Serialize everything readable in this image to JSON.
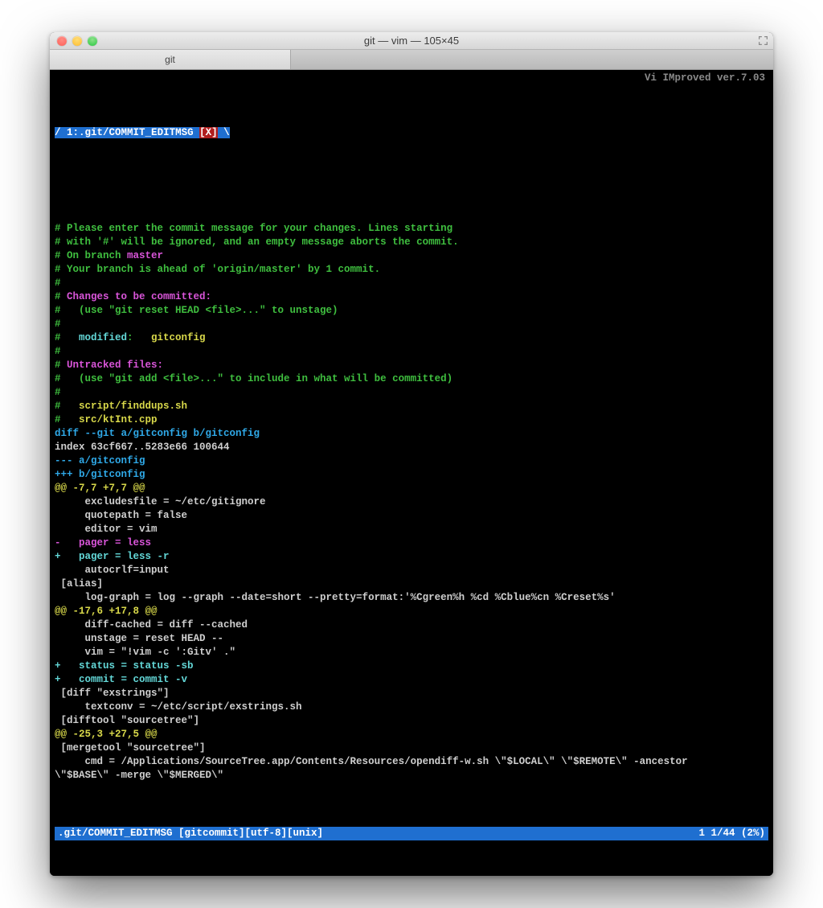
{
  "window": {
    "title": "git — vim — 105×45",
    "tab_label": "git",
    "vim_version": "Vi IMproved ver.7.03",
    "buffer_tab": {
      "index": "1",
      "path": ".git/COMMIT_EDITMSG",
      "modified_flag": "[X]"
    }
  },
  "lines": [
    {
      "t": "comment",
      "segs": [
        [
          "green",
          "# Please enter the commit message for your changes. Lines starting"
        ]
      ]
    },
    {
      "t": "comment",
      "segs": [
        [
          "green",
          "# with '#' will be ignored, and an empty message aborts the commit."
        ]
      ]
    },
    {
      "t": "comment",
      "segs": [
        [
          "green",
          "# On branch "
        ],
        [
          "magenta",
          "master"
        ]
      ]
    },
    {
      "t": "comment",
      "segs": [
        [
          "green",
          "# Your branch is ahead of 'origin/master' by 1 commit."
        ]
      ]
    },
    {
      "t": "comment",
      "segs": [
        [
          "green",
          "#"
        ]
      ]
    },
    {
      "t": "comment",
      "segs": [
        [
          "green",
          "# "
        ],
        [
          "magenta",
          "Changes to be committed:"
        ]
      ]
    },
    {
      "t": "comment",
      "segs": [
        [
          "green",
          "#   (use \"git reset HEAD <file>...\" to unstage)"
        ]
      ]
    },
    {
      "t": "comment",
      "segs": [
        [
          "green",
          "#"
        ]
      ]
    },
    {
      "t": "comment",
      "segs": [
        [
          "green",
          "#   "
        ],
        [
          "cyan",
          "modified"
        ],
        [
          "green",
          ":   "
        ],
        [
          "yellow",
          "gitconfig"
        ]
      ]
    },
    {
      "t": "comment",
      "segs": [
        [
          "green",
          "#"
        ]
      ]
    },
    {
      "t": "comment",
      "segs": [
        [
          "green",
          "# "
        ],
        [
          "magenta",
          "Untracked files:"
        ]
      ]
    },
    {
      "t": "comment",
      "segs": [
        [
          "green",
          "#   (use \"git add <file>...\" to include in what will be committed)"
        ]
      ]
    },
    {
      "t": "comment",
      "segs": [
        [
          "green",
          "#"
        ]
      ]
    },
    {
      "t": "comment",
      "segs": [
        [
          "green",
          "#   "
        ],
        [
          "yellow",
          "script/finddups.sh"
        ]
      ]
    },
    {
      "t": "comment",
      "segs": [
        [
          "green",
          "#   "
        ],
        [
          "yellow",
          "src/ktInt.cpp"
        ]
      ]
    },
    {
      "t": "diff",
      "segs": [
        [
          "blue",
          "diff --git a/gitconfig b/gitconfig"
        ]
      ]
    },
    {
      "t": "diff",
      "segs": [
        [
          "grey",
          "index 63cf667..5283e66 100644"
        ]
      ]
    },
    {
      "t": "diff",
      "segs": [
        [
          "blue",
          "--- a/gitconfig"
        ]
      ]
    },
    {
      "t": "diff",
      "segs": [
        [
          "blue",
          "+++ b/gitconfig"
        ]
      ]
    },
    {
      "t": "hunk",
      "segs": [
        [
          "yellow",
          "@@ -7,7 +7,7 @@"
        ]
      ]
    },
    {
      "t": "ctx",
      "segs": [
        [
          "grey",
          "     excludesfile = ~/etc/gitignore"
        ]
      ]
    },
    {
      "t": "ctx",
      "segs": [
        [
          "grey",
          "     quotepath = false"
        ]
      ]
    },
    {
      "t": "ctx",
      "segs": [
        [
          "grey",
          "     editor = vim"
        ]
      ]
    },
    {
      "t": "del",
      "segs": [
        [
          "magenta",
          "-   pager = less"
        ]
      ]
    },
    {
      "t": "add",
      "segs": [
        [
          "cyan",
          "+   pager = less -r"
        ]
      ]
    },
    {
      "t": "ctx",
      "segs": [
        [
          "grey",
          "     autocrlf=input"
        ]
      ]
    },
    {
      "t": "ctx",
      "segs": [
        [
          "grey",
          " [alias]"
        ]
      ]
    },
    {
      "t": "ctx",
      "segs": [
        [
          "grey",
          "     log-graph = log --graph --date=short --pretty=format:'%Cgreen%h %cd %Cblue%cn %Creset%s'"
        ]
      ]
    },
    {
      "t": "hunk",
      "segs": [
        [
          "yellow",
          "@@ -17,6 +17,8 @@"
        ]
      ]
    },
    {
      "t": "ctx",
      "segs": [
        [
          "grey",
          "     diff-cached = diff --cached"
        ]
      ]
    },
    {
      "t": "ctx",
      "segs": [
        [
          "grey",
          "     unstage = reset HEAD --"
        ]
      ]
    },
    {
      "t": "ctx",
      "segs": [
        [
          "grey",
          "     vim = \"!vim -c ':Gitv' .\""
        ]
      ]
    },
    {
      "t": "add",
      "segs": [
        [
          "cyan",
          "+   status = status -sb"
        ]
      ]
    },
    {
      "t": "add",
      "segs": [
        [
          "cyan",
          "+   commit = commit -v"
        ]
      ]
    },
    {
      "t": "ctx",
      "segs": [
        [
          "grey",
          " [diff \"exstrings\"]"
        ]
      ]
    },
    {
      "t": "ctx",
      "segs": [
        [
          "grey",
          "     textconv = ~/etc/script/exstrings.sh"
        ]
      ]
    },
    {
      "t": "ctx",
      "segs": [
        [
          "grey",
          " [difftool \"sourcetree\"]"
        ]
      ]
    },
    {
      "t": "hunk",
      "segs": [
        [
          "yellow",
          "@@ -25,3 +27,5 @@"
        ]
      ]
    },
    {
      "t": "ctx",
      "segs": [
        [
          "grey",
          " [mergetool \"sourcetree\"]"
        ]
      ]
    },
    {
      "t": "ctx",
      "segs": [
        [
          "grey",
          "     cmd = /Applications/SourceTree.app/Contents/Resources/opendiff-w.sh \\\"$LOCAL\\\" \\\"$REMOTE\\\" -ancestor "
        ]
      ]
    },
    {
      "t": "ctx",
      "segs": [
        [
          "grey",
          "\\\"$BASE\\\" -merge \\\"$MERGED\\\""
        ]
      ]
    }
  ],
  "statusline": {
    "left": ".git/COMMIT_EDITMSG [gitcommit][utf-8][unix]",
    "right": "1 1/44 (2%)"
  }
}
